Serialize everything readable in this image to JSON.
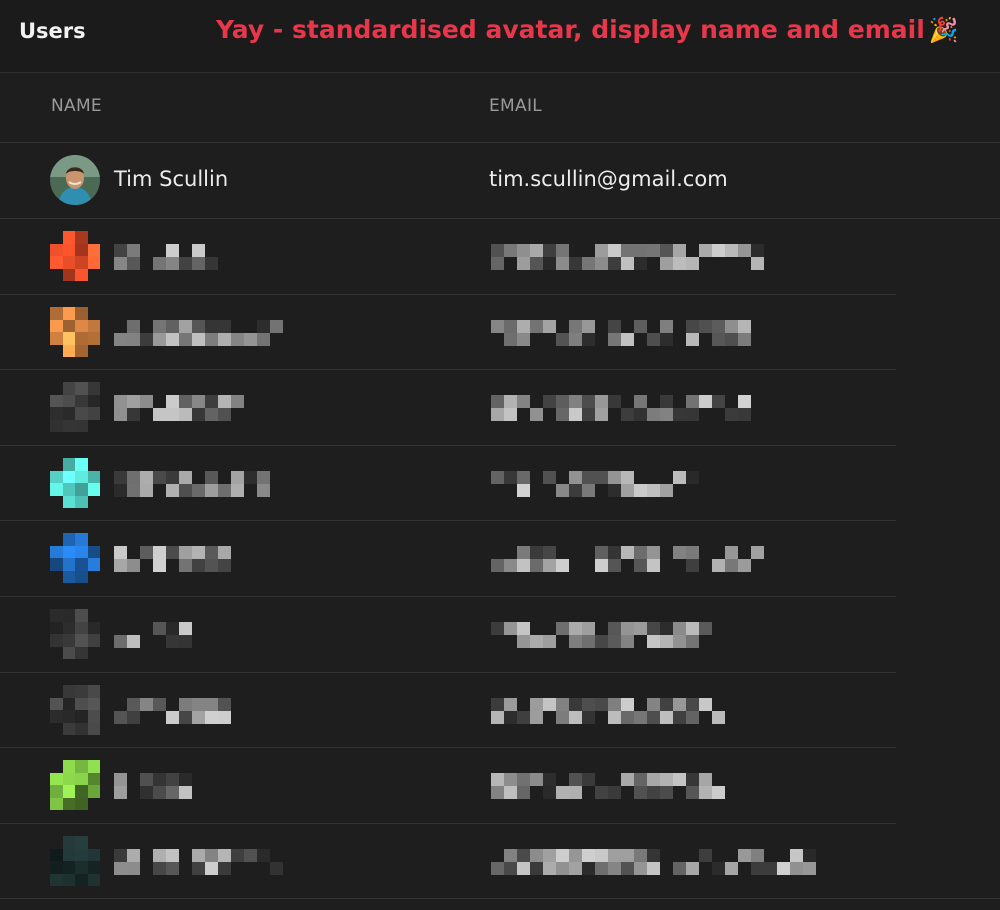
{
  "header": {
    "title": "Users",
    "annotation": "Yay - standardised avatar, display name and email",
    "annotation_emoji": "🎉",
    "annotation_color": "#e8374a"
  },
  "table": {
    "columns": [
      "NAME",
      "EMAIL"
    ],
    "visible_user": {
      "name": "Tim Scullin",
      "email": "tim.scullin@gmail.com"
    },
    "redacted_rows": [
      {
        "avatar_color": "#f0502a"
      },
      {
        "avatar_color": "#f0944a"
      },
      {
        "avatar_color": "#3a3a3a"
      },
      {
        "avatar_color": "#4fc3b8"
      },
      {
        "avatar_color": "#1d5fa8"
      },
      {
        "avatar_color": "#3a3a3a"
      },
      {
        "avatar_color": "#3a3a3a"
      },
      {
        "avatar_color": "#6aa43a"
      },
      {
        "avatar_color": "#1a2a2a"
      }
    ]
  }
}
